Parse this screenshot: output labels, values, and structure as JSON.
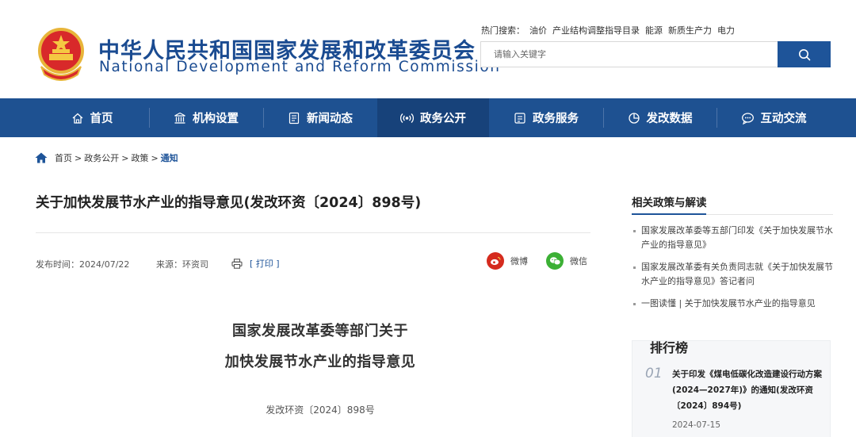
{
  "header": {
    "title_cn": "中华人民共和国国家发展和改革委员会",
    "title_en": "National Development and Reform Commission",
    "hot_label": "热门搜索：",
    "hot_items": [
      "油价",
      "产业结构调整指导目录",
      "能源",
      "新质生产力",
      "电力"
    ],
    "search_placeholder": "请输入关键字",
    "emblem_icon": "national-emblem",
    "search_icon": "search-icon"
  },
  "nav": {
    "items": [
      {
        "label": "首页",
        "icon": "home-icon"
      },
      {
        "label": "机构设置",
        "icon": "building-icon"
      },
      {
        "label": "新闻动态",
        "icon": "news-icon"
      },
      {
        "label": "政务公开",
        "icon": "broadcast-icon",
        "active": true
      },
      {
        "label": "政务服务",
        "icon": "service-icon"
      },
      {
        "label": "发改数据",
        "icon": "pie-chart-icon"
      },
      {
        "label": "互动交流",
        "icon": "chat-icon"
      }
    ]
  },
  "breadcrumb": {
    "items": [
      "首页",
      "政务公开",
      "政策",
      "通知"
    ],
    "separator": ">"
  },
  "article": {
    "title": "关于加快发展节水产业的指导意见(发改环资〔2024〕898号)",
    "publish_time": "发布时间：2024/07/22",
    "source": "来源：环资司",
    "print_label": "[ 打印 ]",
    "share_weibo": "微博",
    "share_wechat": "微信",
    "doc_heading_1": "国家发展改革委等部门关于",
    "doc_heading_2": "加快发展节水产业的指导意见",
    "doc_number": "发改环资〔2024〕898号"
  },
  "sidebar": {
    "related_title": "相关政策与解读",
    "related_items": [
      "国家发展改革委等五部门印发《关于加快发展节水产业的指导意见》",
      "国家发展改革委有关负责同志就《关于加快发展节水产业的指导意见》答记者问",
      "一图读懂 | 关于加快发展节水产业的指导意见"
    ],
    "ranking_title": "排行榜",
    "ranking": [
      {
        "num": "01",
        "text": "关于印发《煤电低碳化改造建设行动方案(2024—2027年)》的通知(发改环资〔2024〕894号)",
        "date": "2024-07-15"
      }
    ]
  },
  "colors": {
    "brand_blue": "#1e5191",
    "nav_active": "#17427a",
    "weibo_red": "#d52b1e",
    "wechat_green": "#3cb035"
  }
}
